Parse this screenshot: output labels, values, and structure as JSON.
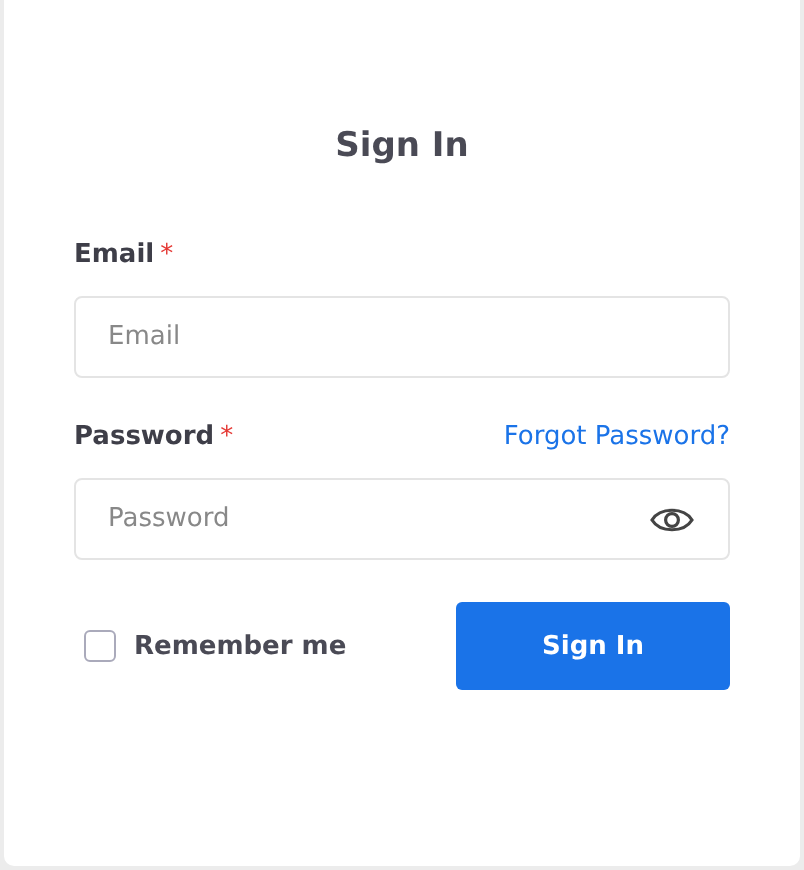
{
  "title": "Sign In",
  "email": {
    "label": "Email",
    "required_mark": "*",
    "placeholder": "Email"
  },
  "password": {
    "label": "Password",
    "required_mark": "*",
    "placeholder": "Password",
    "forgot_link": "Forgot Password?"
  },
  "remember": {
    "label": "Remember me",
    "checked": false
  },
  "submit": {
    "label": "Sign In"
  }
}
